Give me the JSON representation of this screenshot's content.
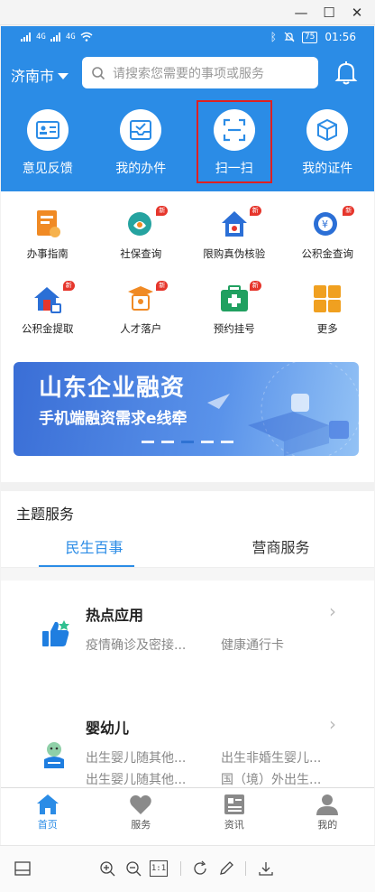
{
  "window": {
    "minimize_glyph": "—",
    "maximize_glyph": "☐",
    "close_glyph": "✕"
  },
  "statusbar": {
    "signal_1": "4G",
    "signal_2": "4G",
    "battery": "75",
    "time": "01:56"
  },
  "header": {
    "city": "济南市",
    "search_placeholder": "请搜索您需要的事项或服务"
  },
  "quick_actions": [
    {
      "label": "意见反馈",
      "icon": "feedback-card-icon"
    },
    {
      "label": "我的办件",
      "icon": "inbox-check-icon"
    },
    {
      "label": "扫一扫",
      "icon": "scan-icon",
      "highlighted": true
    },
    {
      "label": "我的证件",
      "icon": "cube-icon"
    }
  ],
  "services": [
    {
      "label": "办事指南",
      "icon": "guide-icon",
      "new": false,
      "color": "#f08a24"
    },
    {
      "label": "社保查询",
      "icon": "social-security-icon",
      "new": true,
      "color": "#25a3a0"
    },
    {
      "label": "限购真伪核验",
      "icon": "house-verify-icon",
      "new": true,
      "color": "#2b6fd6"
    },
    {
      "label": "公积金查询",
      "icon": "fund-query-icon",
      "new": true,
      "color": "#2b6fd6"
    },
    {
      "label": "公积金提取",
      "icon": "fund-withdraw-icon",
      "new": true,
      "color": "#2b6fd6"
    },
    {
      "label": "人才落户",
      "icon": "talent-icon",
      "new": true,
      "color": "#f08a24"
    },
    {
      "label": "预约挂号",
      "icon": "medical-kit-icon",
      "new": true,
      "color": "#20a060"
    },
    {
      "label": "更多",
      "icon": "more-grid-icon",
      "new": false,
      "color": "#f0a020"
    }
  ],
  "badge_new": "新",
  "banner": {
    "title": "山东企业融资",
    "subtitle": "手机端融资需求e线牵"
  },
  "topic": {
    "title": "主题服务",
    "tabs": [
      {
        "label": "民生百事",
        "active": true
      },
      {
        "label": "营商服务",
        "active": false
      }
    ]
  },
  "cards": [
    {
      "title": "热点应用",
      "items": [
        "疫情确诊及密接...",
        "健康通行卡"
      ]
    },
    {
      "title": "婴幼儿",
      "items": [
        "出生婴儿随其他...",
        "出生非婚生婴儿...",
        "出生婴儿随其他...",
        "国（境）外出生..."
      ]
    }
  ],
  "tabbar": [
    {
      "label": "首页",
      "icon": "home-icon",
      "active": true
    },
    {
      "label": "服务",
      "icon": "heart-icon",
      "active": false
    },
    {
      "label": "资讯",
      "icon": "news-icon",
      "active": false
    },
    {
      "label": "我的",
      "icon": "person-icon",
      "active": false
    }
  ],
  "viewer_toolbar": {
    "actual_size_label": "1:1"
  },
  "colors": {
    "primary": "#2b8ce6",
    "badge": "#e6362c",
    "highlight_box": "#e02020"
  }
}
